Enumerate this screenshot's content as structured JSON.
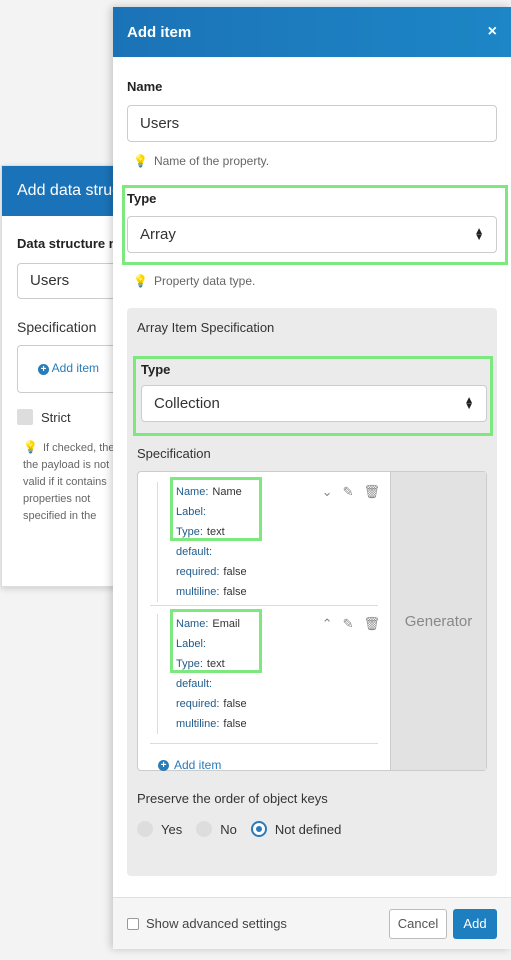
{
  "back_panel": {
    "title": "Add data structure",
    "data_structure_label": "Data structure name",
    "data_structure_value": "Users",
    "spec_label": "Specification",
    "add_item": "Add item",
    "strict_label": "Strict",
    "hint": "If checked, the the payload is not valid if it contains properties not specified in the"
  },
  "dialog": {
    "title": "Add item",
    "close": "×",
    "name_label": "Name",
    "name_value": "Users",
    "name_hint": "Name of the property.",
    "type_label": "Type",
    "type_value": "Array",
    "type_hint": "Property data type.",
    "array_title": "Array Item Specification",
    "inner_type_label": "Type",
    "inner_type_value": "Collection",
    "spec_label": "Specification",
    "generator": "Generator",
    "items": [
      {
        "rows": [
          {
            "key": "Name:",
            "val": "Name"
          },
          {
            "key": "Label:",
            "val": ""
          },
          {
            "key": "Type:",
            "val": "text"
          },
          {
            "key": "default:",
            "val": ""
          },
          {
            "key": "required:",
            "val": "false"
          },
          {
            "key": "multiline:",
            "val": "false"
          }
        ]
      },
      {
        "rows": [
          {
            "key": "Name:",
            "val": "Email"
          },
          {
            "key": "Label:",
            "val": ""
          },
          {
            "key": "Type:",
            "val": "text"
          },
          {
            "key": "default:",
            "val": ""
          },
          {
            "key": "required:",
            "val": "false"
          },
          {
            "key": "multiline:",
            "val": "false"
          }
        ]
      }
    ],
    "add_item": "Add item",
    "preserve_label": "Preserve the order of object keys",
    "radio_yes": "Yes",
    "radio_no": "No",
    "radio_nd": "Not defined",
    "advanced_label": "Show advanced settings",
    "cancel": "Cancel",
    "add": "Add"
  },
  "colors": {
    "header": "#1b73b7",
    "highlight": "#7de87d",
    "accent": "#2a7bb8"
  }
}
